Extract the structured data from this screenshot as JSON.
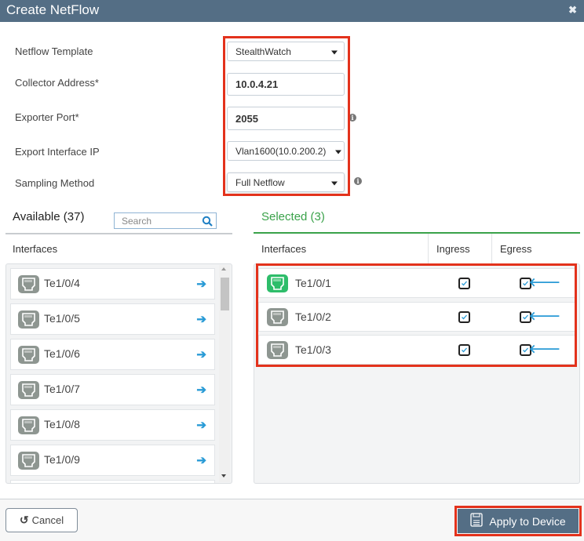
{
  "dialog": {
    "title": "Create NetFlow",
    "close_icon": "x-close-icon"
  },
  "form": {
    "netflow_template": {
      "label": "Netflow Template",
      "value": "StealthWatch"
    },
    "collector_address": {
      "label": "Collector Address*",
      "value": "10.0.4.21"
    },
    "exporter_port": {
      "label": "Exporter Port*",
      "value": "2055"
    },
    "export_interface_ip": {
      "label": "Export Interface IP",
      "value": "Vlan1600(10.0.200.2)"
    },
    "sampling_method": {
      "label": "Sampling Method",
      "value": "Full Netflow"
    }
  },
  "available": {
    "title": "Available (37)",
    "search_placeholder": "Search",
    "column_header": "Interfaces",
    "items": [
      {
        "name": "Te1/0/4"
      },
      {
        "name": "Te1/0/5"
      },
      {
        "name": "Te1/0/6"
      },
      {
        "name": "Te1/0/7"
      },
      {
        "name": "Te1/0/8"
      },
      {
        "name": "Te1/0/9"
      }
    ]
  },
  "selected": {
    "title": "Selected (3)",
    "columns": {
      "interfaces": "Interfaces",
      "ingress": "Ingress",
      "egress": "Egress"
    },
    "items": [
      {
        "name": "Te1/0/1",
        "status": "up",
        "ingress": true,
        "egress": true
      },
      {
        "name": "Te1/0/2",
        "status": "down",
        "ingress": true,
        "egress": true
      },
      {
        "name": "Te1/0/3",
        "status": "down",
        "ingress": true,
        "egress": true
      }
    ]
  },
  "footer": {
    "cancel_label": "Cancel",
    "apply_label": "Apply to Device"
  },
  "colors": {
    "header": "#546e85",
    "accent_green": "#3aa24a",
    "port_up": "#2ebd6a",
    "port_down": "#8e9691",
    "arrow_blue": "#2a9bd6",
    "highlight_red": "#e3321c"
  }
}
